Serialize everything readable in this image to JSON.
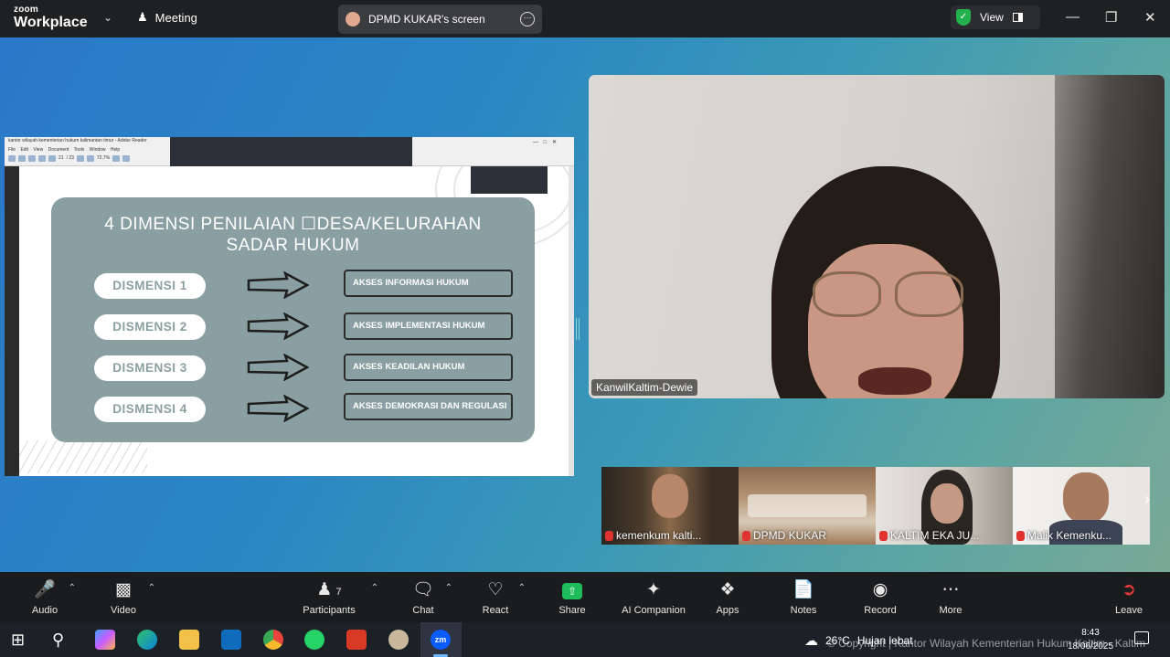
{
  "app": {
    "logo_line1": "zoom",
    "logo_line2": "Workplace",
    "meeting_label": "Meeting",
    "screen_owner": "DPMD KUKAR's screen",
    "view_label": "View"
  },
  "shared_screen": {
    "acrobat_title": "kantor wilayah kementerian hukum kalimantan timur - Adobe Reader",
    "acrobat_menu": "File Edit View Document Tools Window Help",
    "page_current": "21",
    "page_total": "/ 23",
    "zoom": "72,7%",
    "slide_title_line1": "4 DIMENSI PENILAIAN ☐DESA/KELURAHAN",
    "slide_title_line2": "SADAR HUKUM",
    "dimensions": [
      {
        "label": "DISMENSI 1",
        "target": "AKSES INFORMASI HUKUM"
      },
      {
        "label": "DISMENSI 2",
        "target": "AKSES IMPLEMENTASI HUKUM"
      },
      {
        "label": "DISMENSI 3",
        "target": "AKSES KEADILAN HUKUM"
      },
      {
        "label": "DISMENSI 4",
        "target": "AKSES DEMOKRASI DAN REGULASI"
      }
    ]
  },
  "speaker": {
    "name": "KanwilKaltim-Dewie"
  },
  "participants": [
    {
      "name": "kemenkum kalti...",
      "muted": true
    },
    {
      "name": "DPMD KUKAR",
      "muted": true
    },
    {
      "name": "KALTIM EKA JU...",
      "muted": true
    },
    {
      "name": "Malik Kemenku...",
      "muted": true
    }
  ],
  "controls": {
    "audio": "Audio",
    "video": "Video",
    "participants": "Participants",
    "participants_count": "7",
    "chat": "Chat",
    "react": "React",
    "share": "Share",
    "ai_companion": "AI Companion",
    "apps": "Apps",
    "notes": "Notes",
    "record": "Record",
    "more": "More",
    "leave": "Leave"
  },
  "taskbar": {
    "temperature": "26°C",
    "weather": "Hujan lebat",
    "time": "8:43",
    "date": "18/06/2025"
  },
  "watermark": "© Copyright | Kantor Wilayah Kementerian Hukum Kaltim - Kaltim",
  "colors": {
    "stage_start": "#2a78c9",
    "stage_end": "#7aa996",
    "card": "#8a9fa2",
    "share_green": "#1ebc5b",
    "leave_red": "#e83a3a"
  }
}
